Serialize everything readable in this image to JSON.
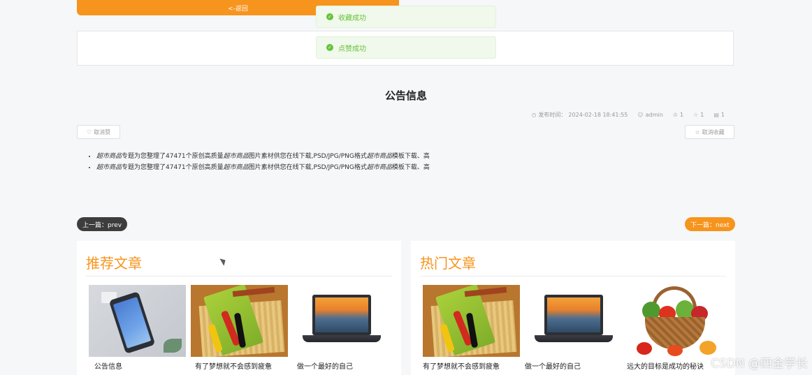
{
  "back_button": {
    "label": "<-返回"
  },
  "toasts": [
    {
      "text": "收藏成功"
    },
    {
      "text": "点赞成功"
    }
  ],
  "article": {
    "title": "公告信息",
    "meta": {
      "publish_label": "发布时间：",
      "publish_time": "2024-02-18 18:41:55",
      "author": "admin",
      "likes": "1",
      "favorites": "1",
      "comments": "1"
    },
    "unlike_button": "取消赞",
    "unfavorite_button": "取消收藏",
    "paragraphs": [
      {
        "em1": "超市商品",
        "t1": "专题为您整理了47471个原创高质量",
        "em2": "超市商品",
        "t2": "图片素材供您在线下载,PSD/JPG/PNG格式",
        "em3": "超市商品",
        "t3": "模板下载、高"
      },
      {
        "em1": "超市商品",
        "t1": "专题为您整理了47471个原创高质量",
        "em2": "超市商品",
        "t2": "图片素材供您在线下载,PSD/JPG/PNG格式",
        "em3": "超市商品",
        "t3": "模板下载、高"
      }
    ]
  },
  "pager": {
    "prev": "上一篇：prev",
    "next": "下一篇：next"
  },
  "recommended": {
    "title": "推荐文章",
    "items": [
      {
        "label": "公告信息",
        "image": "phone"
      },
      {
        "label": "有了梦想就不会感到疲惫",
        "image": "tools"
      },
      {
        "label": "做一个最好的自己",
        "image": "laptop"
      }
    ]
  },
  "popular": {
    "title": "热门文章",
    "items": [
      {
        "label": "有了梦想就不会感到疲惫",
        "image": "tools"
      },
      {
        "label": "做一个最好的自己",
        "image": "laptop"
      },
      {
        "label": "远大的目标是成功的秘诀",
        "image": "vegetables"
      }
    ]
  },
  "watermark": "CSDN @四金学长",
  "colors": {
    "accent": "#f7941d",
    "success": "#67c23a",
    "dark_pill": "#3d3d3d"
  }
}
